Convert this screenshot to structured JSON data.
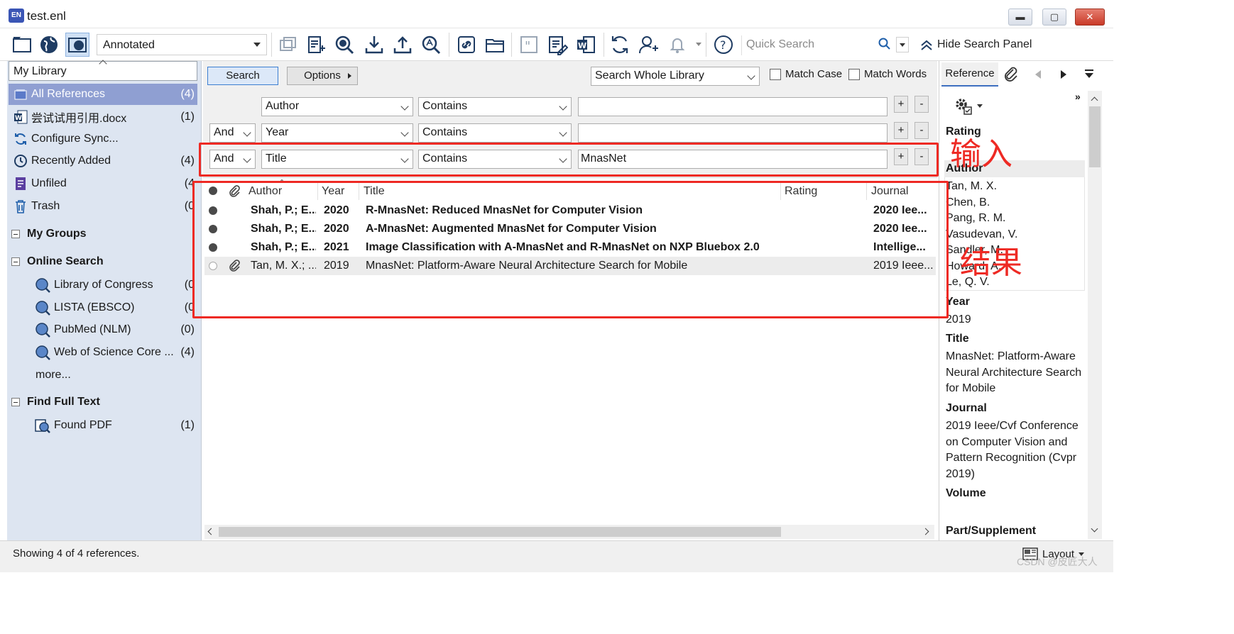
{
  "window": {
    "title": "test.enl",
    "logo": "EN",
    "minimize": "▬",
    "maximize": "▢",
    "close": "✕"
  },
  "toolbar": {
    "style": "Annotated",
    "quick_search_placeholder": "Quick Search",
    "hide_search_panel": "Hide Search Panel"
  },
  "sidebar": {
    "library_label": "My Library",
    "items": [
      {
        "label": "All References",
        "count": "(4)"
      },
      {
        "label": "尝试试用引用.docx",
        "count": "(1)"
      },
      {
        "label": "Configure Sync...",
        "count": ""
      },
      {
        "label": "Recently Added",
        "count": "(4)"
      },
      {
        "label": "Unfiled",
        "count": "(4"
      },
      {
        "label": "Trash",
        "count": "(0"
      }
    ],
    "my_groups": "My Groups",
    "online_search": "Online Search",
    "online_items": [
      {
        "label": "Library of Congress",
        "count": "(0"
      },
      {
        "label": "LISTA (EBSCO)",
        "count": "(0"
      },
      {
        "label": "PubMed (NLM)",
        "count": "(0)"
      },
      {
        "label": "Web of Science Core ...",
        "count": "(4)"
      }
    ],
    "more": "more...",
    "find_full_text": "Find Full Text",
    "found_pdf": {
      "label": "Found PDF",
      "count": "(1)"
    }
  },
  "search_panel": {
    "search_button": "Search",
    "options_button": "Options",
    "scope": "Search Whole Library",
    "match_case": "Match Case",
    "match_words": "Match Words",
    "rows": [
      {
        "bool": "",
        "field": "Author",
        "op": "Contains",
        "value": ""
      },
      {
        "bool": "And",
        "field": "Year",
        "op": "Contains",
        "value": ""
      },
      {
        "bool": "And",
        "field": "Title",
        "op": "Contains",
        "value": "MnasNet"
      }
    ],
    "plus": "+",
    "minus": "-"
  },
  "reference_list": {
    "columns": {
      "author": "Author",
      "year": "Year",
      "title": "Title",
      "rating": "Rating",
      "journal": "Journal"
    },
    "rows": [
      {
        "author": "Shah, P.; E...",
        "year": "2020",
        "title": "R-MnasNet: Reduced MnasNet for Computer Vision",
        "journal": "2020 Iee...",
        "unread": true
      },
      {
        "author": "Shah, P.; E...",
        "year": "2020",
        "title": "A-MnasNet: Augmented MnasNet for Computer Vision",
        "journal": "2020 Iee...",
        "unread": true
      },
      {
        "author": "Shah, P.; E...",
        "year": "2021",
        "title": "Image Classification with A-MnasNet and R-MnasNet on NXP Bluebox 2.0",
        "journal": "Intellige...",
        "unread": true
      },
      {
        "author": "Tan, M. X.; ...",
        "year": "2019",
        "title": "MnasNet: Platform-Aware Neural Architecture Search for Mobile",
        "journal": "2019 Ieee...",
        "unread": false
      }
    ]
  },
  "right_panel": {
    "tab": "Reference",
    "rating_label": "Rating",
    "author_label": "Author",
    "authors": [
      "Tan, M. X.",
      "Chen, B.",
      "Pang, R. M.",
      "Vasudevan, V.",
      "Sandler, M.",
      "Howard, A.",
      "Le, Q. V."
    ],
    "year_label": "Year",
    "year": "2019",
    "title_label": "Title",
    "title": "MnasNet: Platform-Aware Neural Architecture Search for Mobile",
    "journal_label": "Journal",
    "journal": "2019 Ieee/Cvf Conference on Computer Vision and Pattern Recognition (Cvpr 2019)",
    "volume_label": "Volume",
    "part_label": "Part/Supplement"
  },
  "status": {
    "text": "Showing 4 of 4 references.",
    "layout": "Layout"
  },
  "annotations": {
    "input": "输入",
    "result": "结果"
  },
  "watermark": "CSDN @皮匠大人",
  "colors": {
    "selection": "#8f9fd2",
    "annotation": "#ee2a24",
    "sidebar_bg": "#dde5f1"
  }
}
